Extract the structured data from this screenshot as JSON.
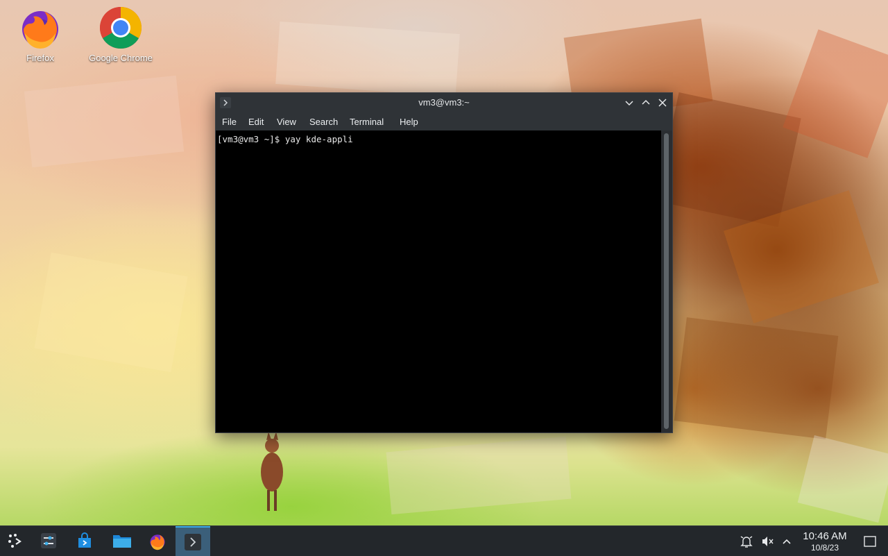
{
  "desktop": {
    "icons": [
      {
        "label": "Firefox",
        "icon": "firefox-icon"
      },
      {
        "label": "Google Chrome",
        "icon": "chrome-icon"
      }
    ]
  },
  "terminal": {
    "title": "vm3@vm3:~",
    "menu": [
      "File",
      "Edit",
      "View",
      "Search",
      "Terminal",
      "Help"
    ],
    "lines": [
      "[vm3@vm3 ~]$ yay kde-appli"
    ]
  },
  "taskbar": {
    "launchers": [
      "application-launcher-icon",
      "system-settings-icon",
      "discover-store-icon",
      "file-manager-icon",
      "firefox-icon",
      "terminal-icon"
    ],
    "tray": [
      "notifications-icon",
      "volume-muted-icon",
      "show-hidden-icons-chevron"
    ],
    "clock": {
      "time": "10:46 AM",
      "date": "10/8/23"
    }
  },
  "colors": {
    "accent": "#3daee9",
    "titlebar": "#2f3337",
    "taskbar": "#23272b"
  }
}
